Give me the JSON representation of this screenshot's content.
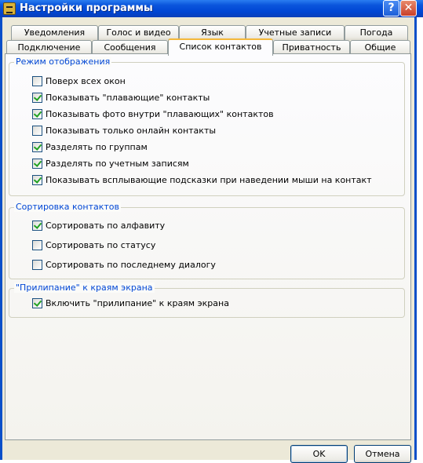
{
  "window": {
    "title": "Настройки программы",
    "help_glyph": "?",
    "close_glyph": "✕"
  },
  "tabs_top": [
    {
      "label": "Уведомления"
    },
    {
      "label": "Голос и видео"
    },
    {
      "label": "Язык"
    },
    {
      "label": "Учетные записи"
    },
    {
      "label": "Погода"
    }
  ],
  "tabs_bottom": [
    {
      "label": "Подключение"
    },
    {
      "label": "Сообщения"
    },
    {
      "label": "Список контактов",
      "active": true
    },
    {
      "label": "Приватность"
    },
    {
      "label": "Общие"
    }
  ],
  "groups": [
    {
      "title": "Режим отображения",
      "items": [
        {
          "label": "Поверх всех окон",
          "checked": false
        },
        {
          "label": "Показывать \"плавающие\" контакты",
          "checked": true
        },
        {
          "label": "Показывать фото внутри \"плавающих\" контактов",
          "checked": true
        },
        {
          "label": "Показывать только онлайн контакты",
          "checked": false
        },
        {
          "label": "Разделять по группам",
          "checked": true
        },
        {
          "label": "Разделять по учетным записям",
          "checked": true
        },
        {
          "label": "Показывать всплывающие подсказки при наведении мыши на контакт",
          "checked": true
        }
      ]
    },
    {
      "title": "Сортировка контактов",
      "items": [
        {
          "label": "Сортировать по алфавиту",
          "checked": true
        },
        {
          "label": "Сортировать по статусу",
          "checked": false
        },
        {
          "label": "Сортировать по последнему диалогу",
          "checked": false
        }
      ]
    },
    {
      "title": "\"Прилипание\" к краям экрана",
      "items": [
        {
          "label": "Включить \"прилипание\" к краям экрана",
          "checked": true
        }
      ]
    }
  ],
  "buttons": {
    "ok": "OK",
    "cancel": "Отмена"
  },
  "colors": {
    "titlebar": "#0a55dc",
    "group_title": "#0046d5",
    "active_tab_accent": "#f4b83a",
    "check": "#21a121"
  }
}
